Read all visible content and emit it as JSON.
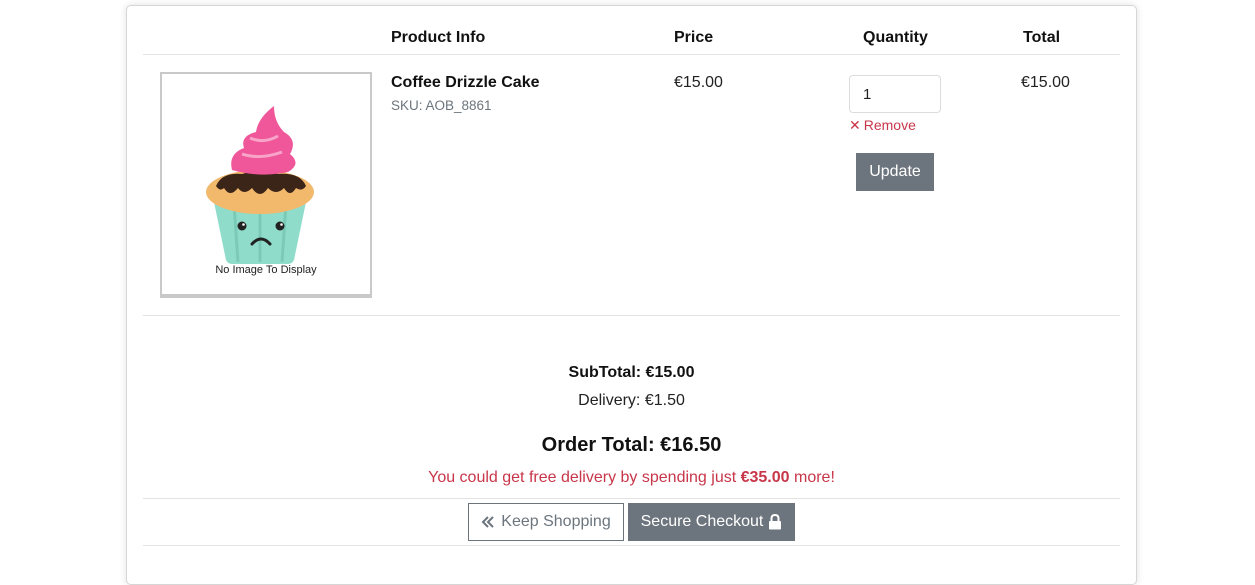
{
  "table_headers": {
    "product_info": "Product Info",
    "price": "Price",
    "quantity": "Quantity",
    "total": "Total"
  },
  "item": {
    "image_caption": "No Image To Display",
    "name": "Coffee Drizzle Cake",
    "sku": "SKU: AOB_8861",
    "price": "€15.00",
    "quantity": "1",
    "remove_label": "Remove",
    "update_label": "Update",
    "total": "€15.00"
  },
  "summary": {
    "subtotal": "SubTotal: €15.00",
    "delivery": "Delivery: €1.50",
    "order_total": "Order Total: €16.50",
    "free_delivery_prefix": "You could get free delivery by spending just ",
    "free_delivery_amount": "€35.00",
    "free_delivery_suffix": " more!"
  },
  "actions": {
    "keep_shopping": "Keep Shopping",
    "secure_checkout": "Secure Checkout"
  },
  "icons": {
    "remove": "close-icon",
    "keep_shopping": "double-chevron-left-icon",
    "checkout": "lock-icon",
    "placeholder": "cupcake-icon"
  },
  "colors": {
    "danger": "#c8364a",
    "secondary": "#6c757d",
    "cupcake_frosting": "#f0569a",
    "cupcake_cup": "#8fdccb"
  }
}
